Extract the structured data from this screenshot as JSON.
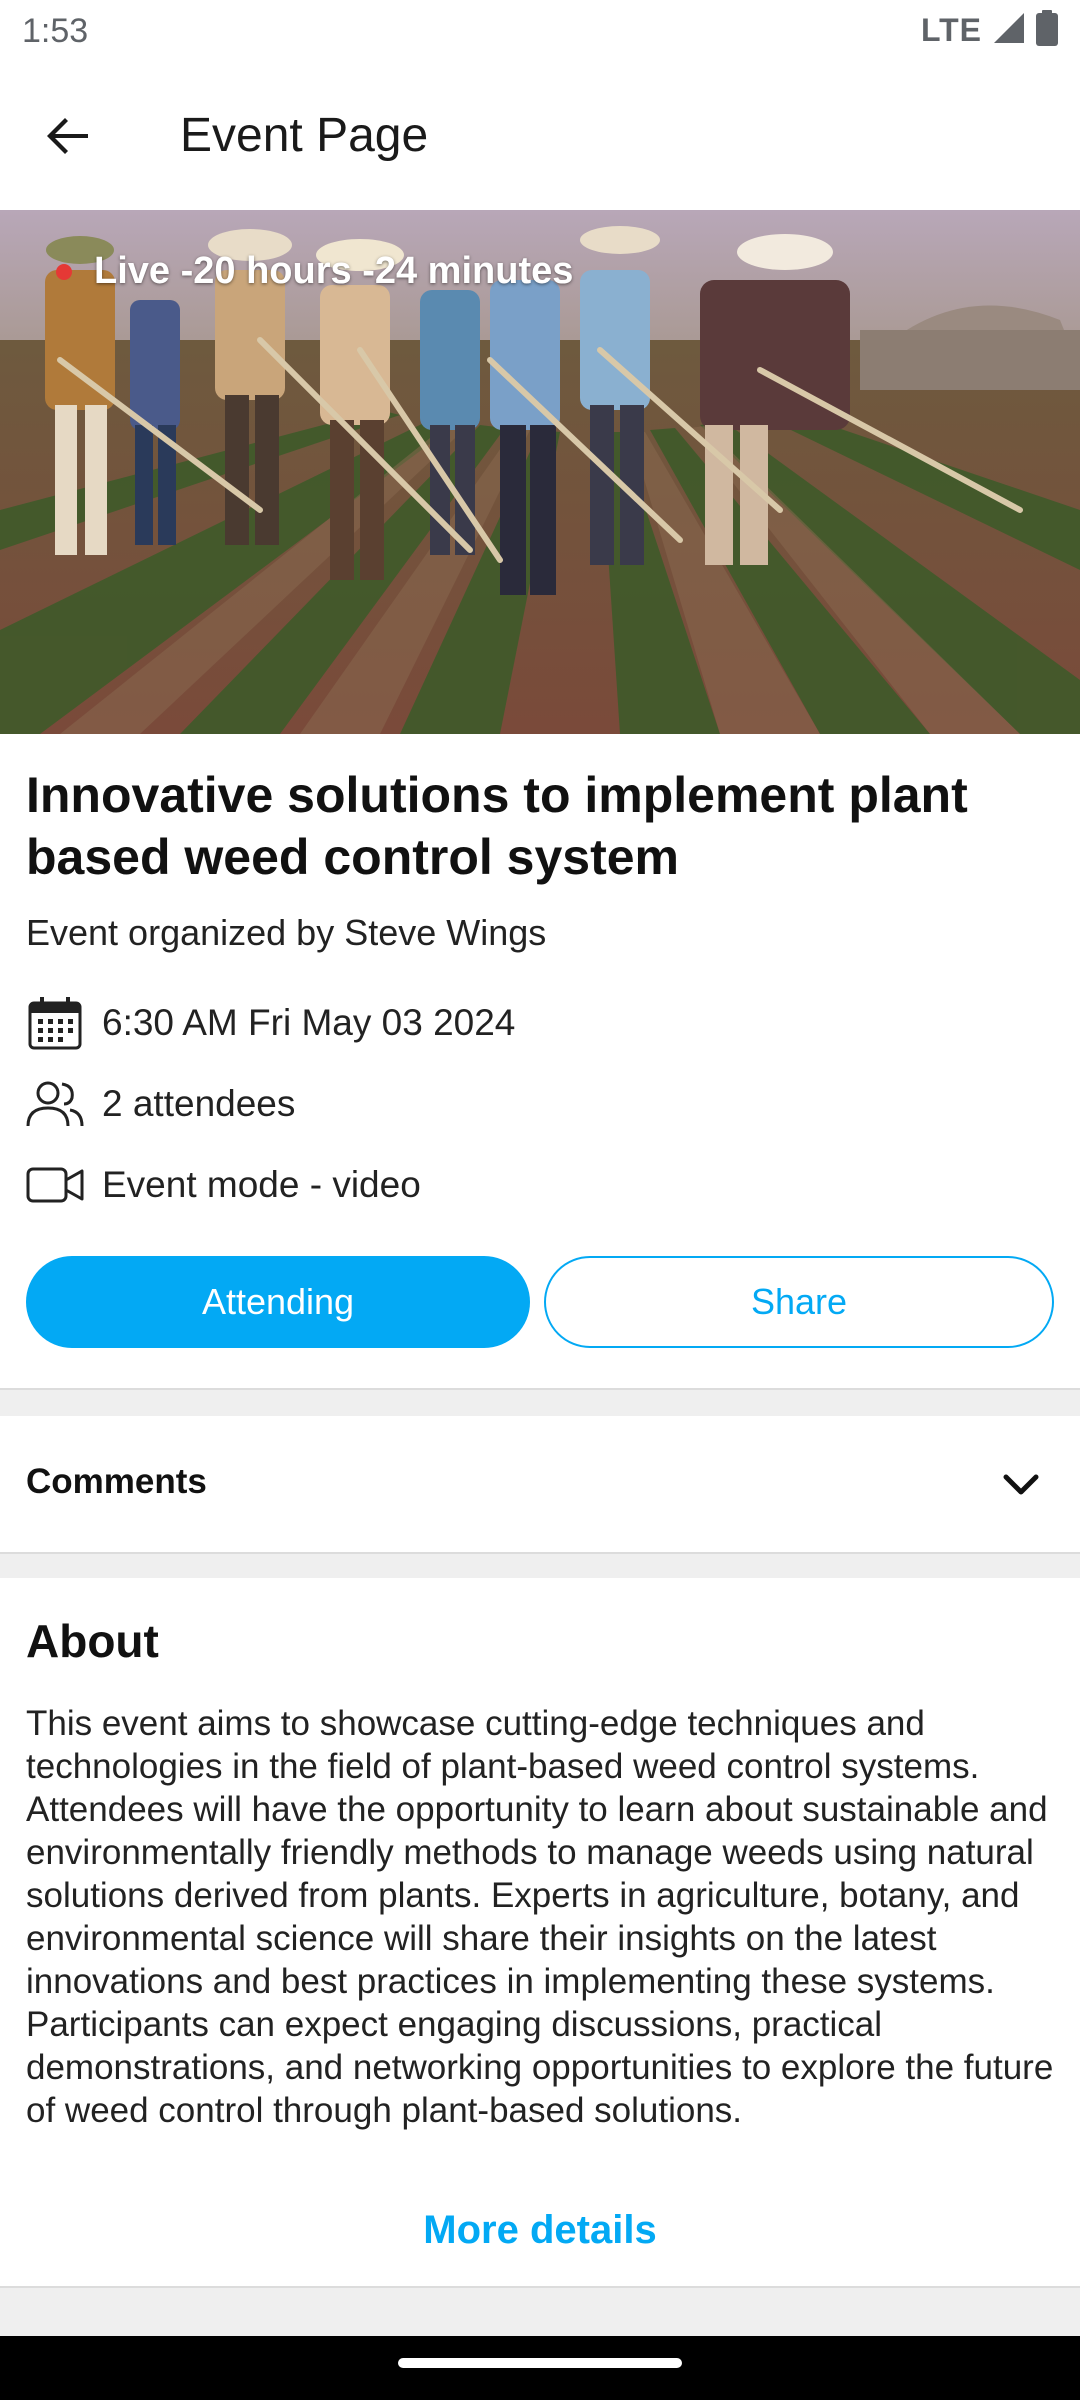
{
  "status_bar": {
    "time": "1:53",
    "network": "LTE"
  },
  "app_bar": {
    "title": "Event Page"
  },
  "hero": {
    "live_text": "Live -20 hours -24 minutes"
  },
  "event": {
    "title": "Innovative solutions to implement plant based weed control system",
    "organizer": "Event organized by Steve Wings",
    "datetime": "6:30 AM Fri May 03 2024",
    "attendees": "2 attendees",
    "mode": "Event mode - video"
  },
  "actions": {
    "attending_label": "Attending",
    "share_label": "Share"
  },
  "comments": {
    "label": "Comments"
  },
  "about": {
    "title": "About",
    "body": "This event aims to showcase cutting-edge techniques and technologies in the field of plant-based weed control systems. Attendees will have the opportunity to learn about sustainable and environmentally friendly methods to manage weeds using natural solutions derived from plants. Experts in agriculture, botany, and environmental science will share their insights on the latest innovations and best practices in implementing these systems. Participants can expect engaging discussions, practical demonstrations, and networking opportunities to explore the future of weed control through plant-based solutions.",
    "more_details": "More details"
  },
  "colors": {
    "accent": "#03a9f4",
    "live_dot": "#e53935"
  }
}
